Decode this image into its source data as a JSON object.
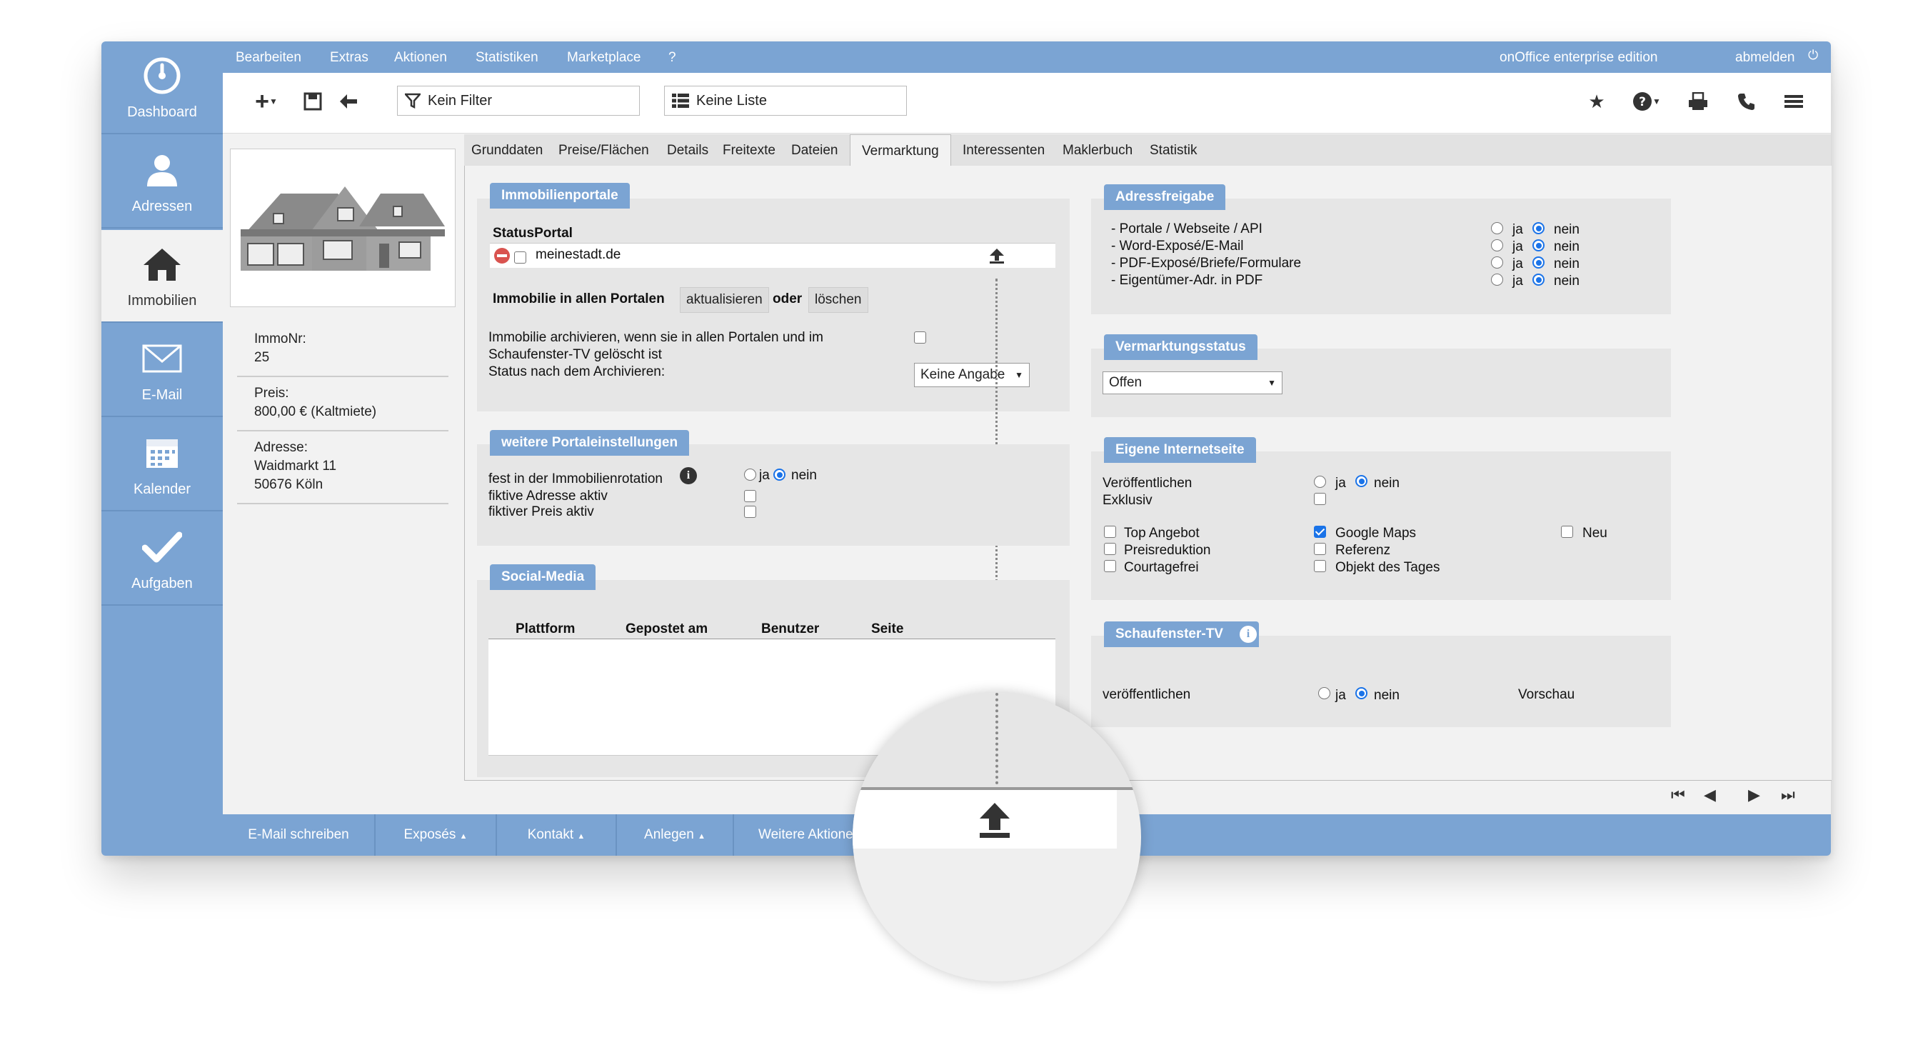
{
  "menu": {
    "items": [
      "Bearbeiten",
      "Extras",
      "Aktionen",
      "Statistiken",
      "Marketplace",
      "?"
    ],
    "edition": "onOffice enterprise edition",
    "logout": "abmelden"
  },
  "sidebar": {
    "items": [
      {
        "label": "Dashboard",
        "icon": "dashboard-icon"
      },
      {
        "label": "Adressen",
        "icon": "person-icon"
      },
      {
        "label": "Immobilien",
        "icon": "house-icon"
      },
      {
        "label": "E-Mail",
        "icon": "envelope-icon"
      },
      {
        "label": "Kalender",
        "icon": "calendar-icon"
      },
      {
        "label": "Aufgaben",
        "icon": "checkmark-icon"
      }
    ]
  },
  "toolbar": {
    "filter": "Kein Filter",
    "list": "Keine Liste"
  },
  "property": {
    "immo_label": "ImmoNr:",
    "immo_value": "25",
    "price_label": "Preis:",
    "price_value": "800,00 € (Kaltmiete)",
    "address_label": "Adresse:",
    "address_line1": "Waidmarkt 11",
    "address_line2": "50676 Köln"
  },
  "tabs": [
    "Grunddaten",
    "Preise/Flächen",
    "Details",
    "Freitexte",
    "Dateien",
    "Vermarktung",
    "Interessenten",
    "Maklerbuch",
    "Statistik"
  ],
  "immobilienportale": {
    "title": "Immobilienportale",
    "status_header": "StatusPortal",
    "portal_name": "meinestadt.de",
    "all_portals_label": "Immobilie in allen Portalen",
    "update_button": "aktualisieren",
    "or_label": "oder",
    "delete_button": "löschen",
    "archive_line1": "Immobilie archivieren, wenn sie in allen Portalen und im",
    "archive_line2": "Schaufenster-TV gelöscht ist",
    "archive_status_label": "Status nach dem Archivieren:",
    "archive_status_value": "Keine Angabe"
  },
  "weitere": {
    "title": "weitere Portaleinstellungen",
    "rotation_label": "fest in der Immobilienrotation",
    "yes": "ja",
    "no": "nein",
    "fictive_address": "fiktive Adresse aktiv",
    "fictive_price": "fiktiver Preis aktiv"
  },
  "social": {
    "title": "Social-Media",
    "columns": [
      "Plattform",
      "Gepostet am",
      "Benutzer",
      "Seite"
    ]
  },
  "adressfreigabe": {
    "title": "Adressfreigabe",
    "rows": [
      "- Portale / Webseite / API",
      "- Word-Exposé/E-Mail",
      "- PDF-Exposé/Briefe/Formulare",
      "- Eigentümer-Adr. in PDF"
    ],
    "yes": "ja",
    "no": "nein"
  },
  "vermarktungsstatus": {
    "title": "Vermarktungsstatus",
    "value": "Offen"
  },
  "internetseite": {
    "title": "Eigene Internetseite",
    "publish_label": "Veröffentlichen",
    "exclusive_label": "Exklusiv",
    "yes": "ja",
    "no": "nein",
    "checks": [
      {
        "label": "Top Angebot",
        "checked": false
      },
      {
        "label": "Preisreduktion",
        "checked": false
      },
      {
        "label": "Courtagefrei",
        "checked": false
      },
      {
        "label": "Google Maps",
        "checked": true
      },
      {
        "label": "Referenz",
        "checked": false
      },
      {
        "label": "Objekt des Tages",
        "checked": false
      },
      {
        "label": "Neu",
        "checked": false
      }
    ]
  },
  "schaufenster": {
    "title": "Schaufenster-TV",
    "publish_label": "veröffentlichen",
    "yes": "ja",
    "no": "nein",
    "preview": "Vorschau"
  },
  "footer": {
    "buttons": [
      "E-Mail schreiben",
      "Exposés",
      "Kontakt",
      "Anlegen",
      "Weitere Aktionen"
    ]
  },
  "colors": {
    "accent": "#7ba4d3",
    "radio_selected": "#1a73e8"
  }
}
